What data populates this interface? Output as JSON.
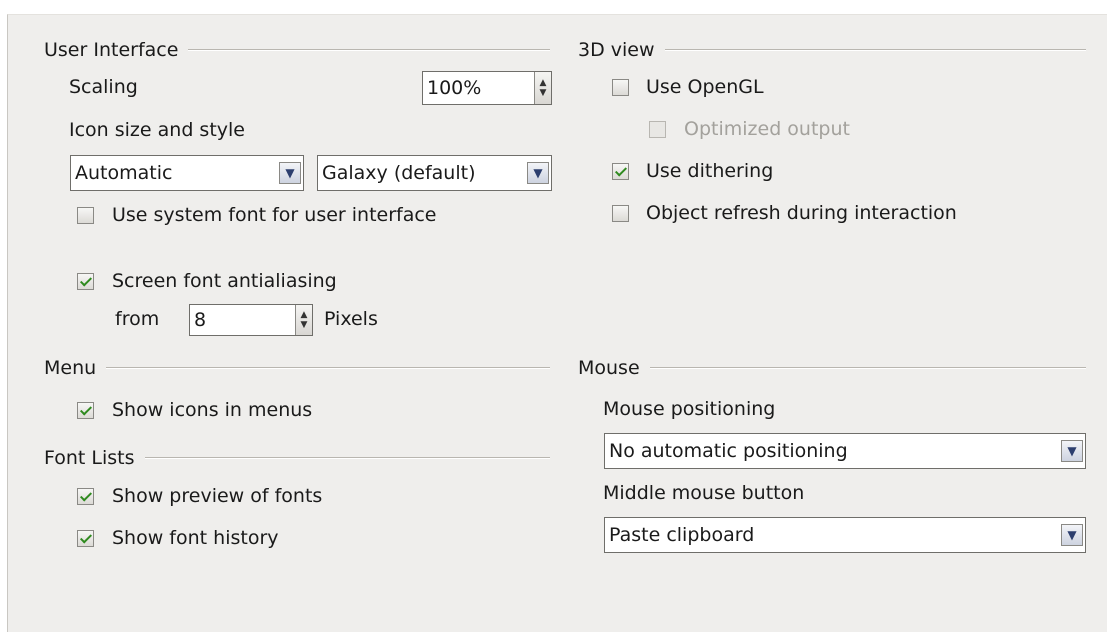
{
  "user_interface": {
    "header": "User Interface",
    "scaling_label": "Scaling",
    "scaling_value": "100%",
    "icon_label": "Icon size and style",
    "icon_size": "Automatic",
    "icon_style": "Galaxy (default)",
    "system_font": {
      "label": "Use system font for user interface",
      "checked": false
    },
    "antialiasing": {
      "label": "Screen font antialiasing",
      "checked": true
    },
    "from_label": "from",
    "from_value": "8",
    "pixels_label": "Pixels"
  },
  "view_3d": {
    "header": "3D view",
    "use_opengl": {
      "label": "Use OpenGL",
      "checked": false
    },
    "optimized_output": {
      "label": "Optimized output",
      "checked": false,
      "disabled": true
    },
    "use_dithering": {
      "label": "Use dithering",
      "checked": true
    },
    "object_refresh": {
      "label": "Object refresh during interaction",
      "checked": false
    }
  },
  "menu": {
    "header": "Menu",
    "show_icons": {
      "label": "Show icons in menus",
      "checked": true
    }
  },
  "font_lists": {
    "header": "Font Lists",
    "show_preview": {
      "label": "Show preview of fonts",
      "checked": true
    },
    "show_history": {
      "label": "Show font history",
      "checked": true
    }
  },
  "mouse": {
    "header": "Mouse",
    "positioning_label": "Mouse positioning",
    "positioning_value": "No automatic positioning",
    "middle_label": "Middle mouse button",
    "middle_value": "Paste clipboard"
  },
  "icons": {
    "checkmark": "check-icon",
    "dropdown": "chevron-down-icon",
    "spin": "spin-arrows-icon"
  },
  "colors": {
    "panel_bg": "#efeeec",
    "check_green": "#2f8a1f",
    "field_bg": "#ffffff"
  }
}
